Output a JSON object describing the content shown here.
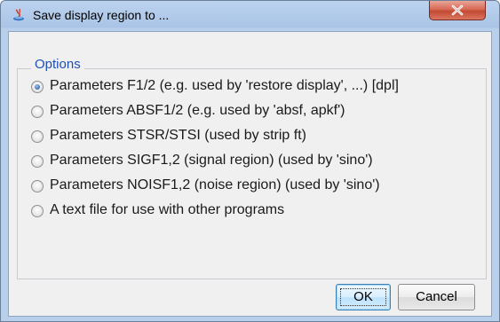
{
  "window": {
    "title": "Save display region to ...",
    "icon": "java-app-icon",
    "close_icon": "close-icon"
  },
  "options_group": {
    "legend": "Options",
    "selected_index": 0,
    "items": [
      {
        "label": "Parameters F1/2 (e.g. used by 'restore display', ...) [dpl]"
      },
      {
        "label": "Parameters ABSF1/2 (e.g. used by 'absf, apkf')"
      },
      {
        "label": "Parameters STSR/STSI (used by strip ft)"
      },
      {
        "label": "Parameters SIGF1,2 (signal region) (used by 'sino')"
      },
      {
        "label": "Parameters NOISF1,2 (noise region) (used by 'sino')"
      },
      {
        "label": "A text file for use with other programs"
      }
    ]
  },
  "buttons": {
    "ok_label": "OK",
    "cancel_label": "Cancel"
  },
  "colors": {
    "legend": "#1f4fb5",
    "titlebar": "#a9c4e6",
    "close_button": "#c44a33"
  }
}
